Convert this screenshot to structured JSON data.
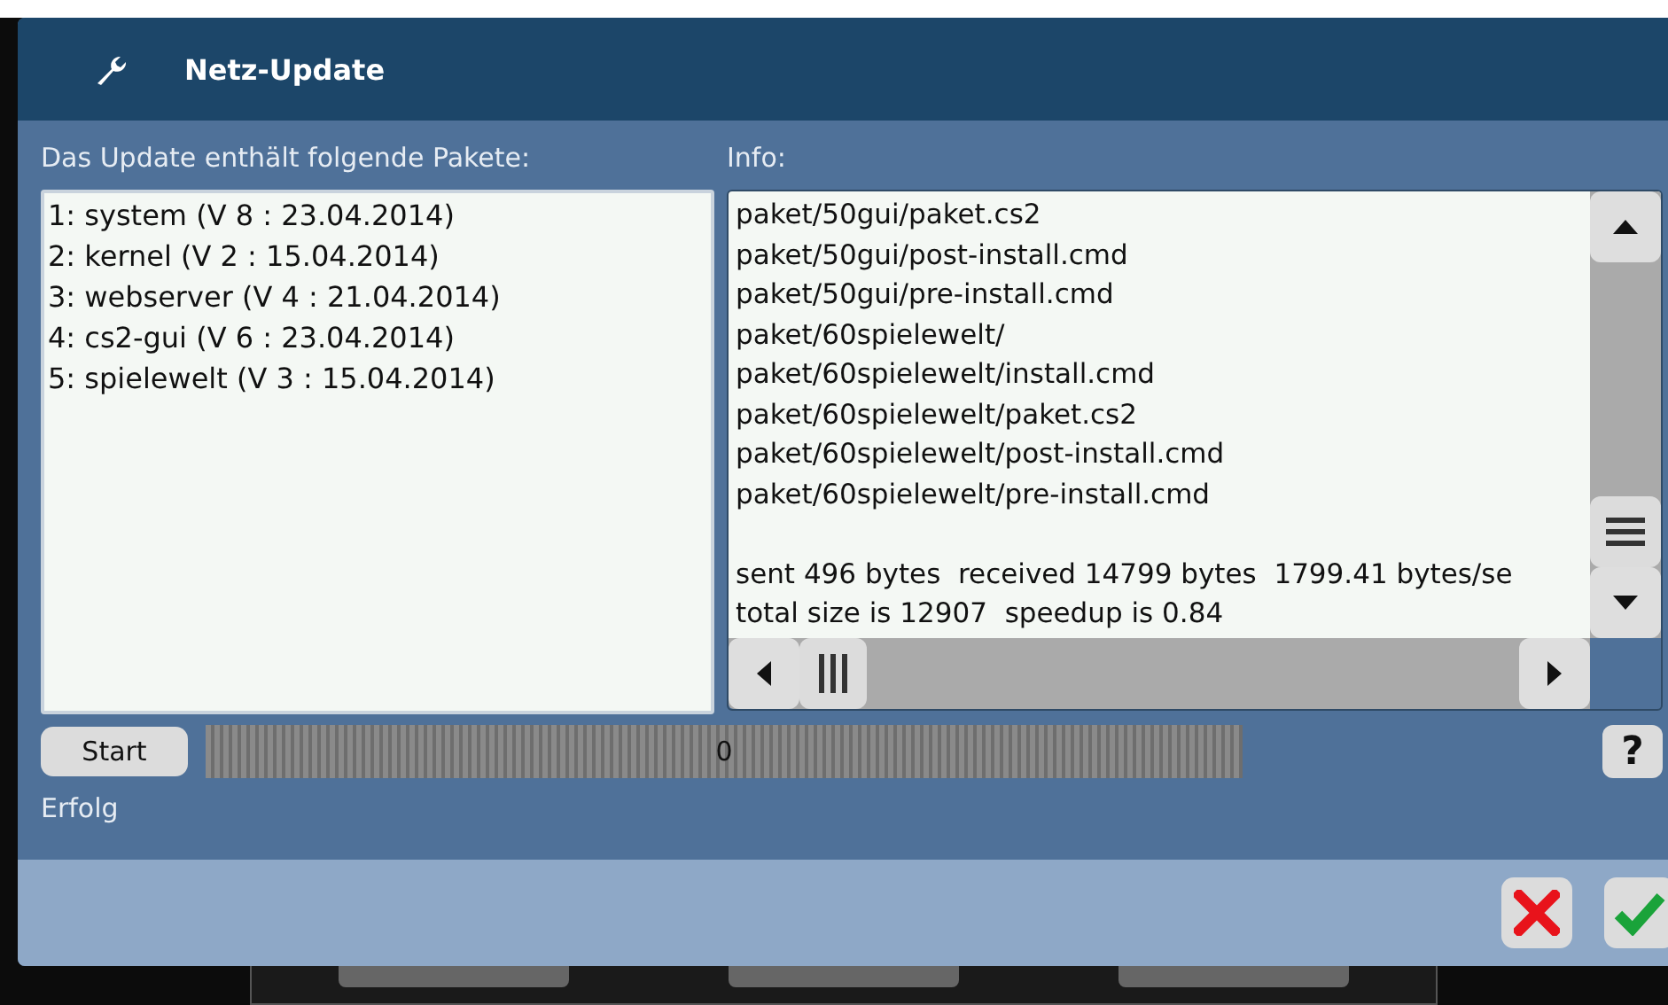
{
  "window": {
    "title": "Netz-Update"
  },
  "packages": {
    "label": "Das Update enthält folgende Pakete:",
    "items": [
      {
        "text": "1: system (V 8 : 23.04.2014)"
      },
      {
        "text": "2: kernel (V 2 : 15.04.2014)"
      },
      {
        "text": "3: webserver (V 4 : 21.04.2014)"
      },
      {
        "text": "4: cs2-gui (V 6 : 23.04.2014)"
      },
      {
        "text": "5: spielewelt (V 3 : 15.04.2014)"
      }
    ]
  },
  "info": {
    "label": "Info:",
    "file_lines": [
      "paket/50gui/paket.cs2",
      "paket/50gui/post-install.cmd",
      "paket/50gui/pre-install.cmd",
      "paket/60spielewelt/",
      "paket/60spielewelt/install.cmd",
      "paket/60spielewelt/paket.cs2",
      "paket/60spielewelt/post-install.cmd",
      "paket/60spielewelt/pre-install.cmd"
    ],
    "summary_lines": [
      "sent 496 bytes  received 14799 bytes  1799.41 bytes/se",
      "total size is 12907  speedup is 0.84"
    ]
  },
  "start_button": "Start",
  "progress": {
    "level": 0,
    "reading": "0"
  },
  "help_button": "?",
  "status": "Erfolg"
}
